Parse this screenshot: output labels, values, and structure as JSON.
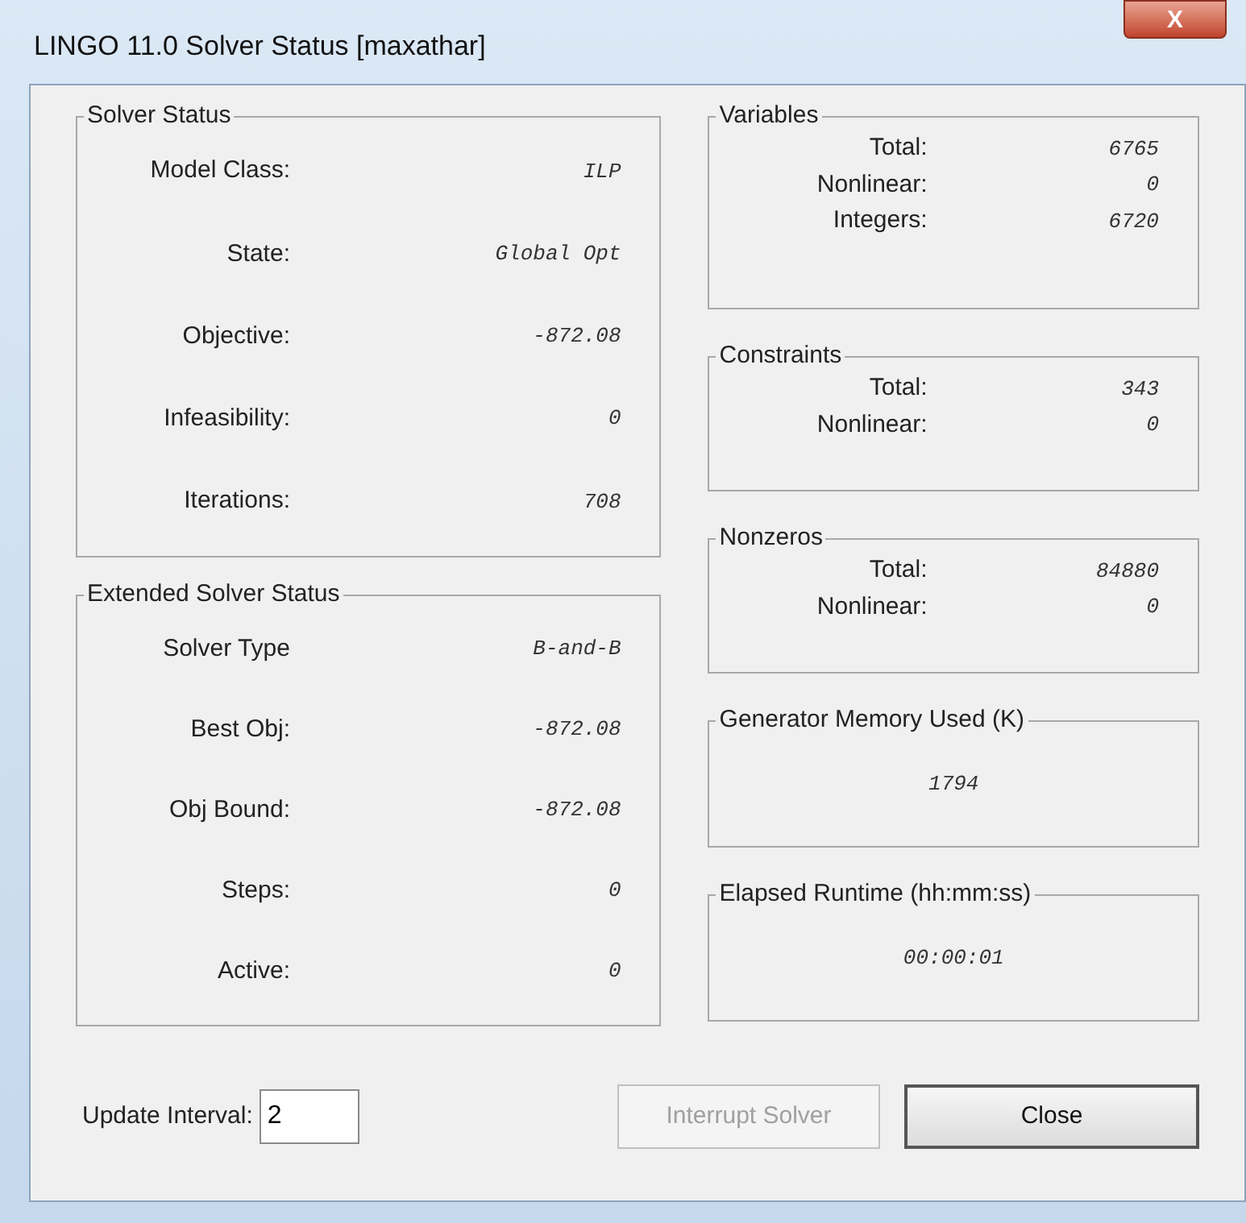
{
  "window": {
    "title": "LINGO 11.0 Solver Status [maxathar]",
    "close_glyph": "X"
  },
  "left_groups": [
    {
      "title": "Solver Status",
      "kind": "rows",
      "rows": [
        {
          "label": "Model Class:",
          "value": "ILP"
        },
        {
          "label": "State:",
          "value": "Global Opt"
        },
        {
          "label": "Objective:",
          "value": "-872.08"
        },
        {
          "label": "Infeasibility:",
          "value": "0"
        },
        {
          "label": "Iterations:",
          "value": "708"
        }
      ]
    },
    {
      "title": "Extended Solver Status",
      "kind": "rows",
      "rows": [
        {
          "label": "Solver Type",
          "value": "B-and-B"
        },
        {
          "label": "Best Obj:",
          "value": "-872.08"
        },
        {
          "label": "Obj Bound:",
          "value": "-872.08"
        },
        {
          "label": "Steps:",
          "value": "0"
        },
        {
          "label": "Active:",
          "value": "0"
        }
      ]
    }
  ],
  "right_groups": [
    {
      "title": "Variables",
      "kind": "rows",
      "rows": [
        {
          "label": "Total:",
          "value": "6765"
        },
        {
          "label": "Nonlinear:",
          "value": "0"
        },
        {
          "label": "Integers:",
          "value": "6720"
        }
      ]
    },
    {
      "title": "Constraints",
      "kind": "rows",
      "rows": [
        {
          "label": "Total:",
          "value": "343"
        },
        {
          "label": "Nonlinear:",
          "value": "0"
        }
      ]
    },
    {
      "title": "Nonzeros",
      "kind": "rows",
      "rows": [
        {
          "label": "Total:",
          "value": "84880"
        },
        {
          "label": "Nonlinear:",
          "value": "0"
        }
      ]
    },
    {
      "title": "Generator Memory Used (K)",
      "kind": "single",
      "value": "1794"
    },
    {
      "title": "Elapsed Runtime (hh:mm:ss)",
      "kind": "single",
      "value": "00:00:01"
    }
  ],
  "update_interval": {
    "label": "Update Interval:",
    "value": "2"
  },
  "buttons": [
    {
      "label": "Interrupt Solver",
      "disabled": true
    },
    {
      "label": "Close",
      "disabled": false
    }
  ]
}
